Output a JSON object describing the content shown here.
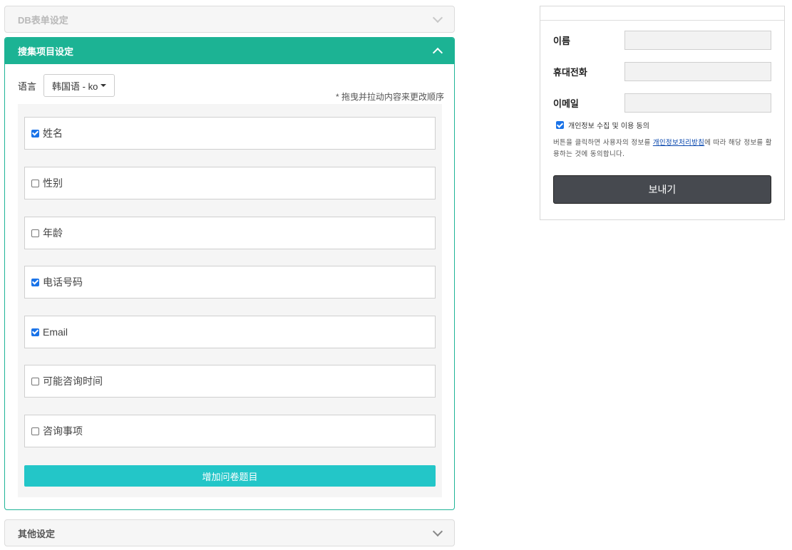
{
  "panels": {
    "db_form": {
      "title": "DB表单设定"
    },
    "collect": {
      "title": "搜集项目设定",
      "language_label": "语言",
      "language_value": "韩国语 - ko",
      "drag_hint": "* 拖曳并拉动内容来更改顺序",
      "items": [
        {
          "label": "姓名",
          "checked": true
        },
        {
          "label": "性别",
          "checked": false
        },
        {
          "label": "年龄",
          "checked": false
        },
        {
          "label": "电话号码",
          "checked": true
        },
        {
          "label": "Email",
          "checked": true
        },
        {
          "label": "可能咨询时间",
          "checked": false
        },
        {
          "label": "咨询事项",
          "checked": false
        }
      ],
      "add_button": "增加问卷题目"
    },
    "other": {
      "title": "其他设定"
    }
  },
  "preview": {
    "fields": [
      {
        "label": "이름"
      },
      {
        "label": "휴대전화"
      },
      {
        "label": "이메일"
      }
    ],
    "consent_label": "개인정보 수집 및 이용 동의",
    "consent_checked": true,
    "notice_before": "버튼을 클릭하면 사용자의 정보를 ",
    "notice_link": "개인정보처리방침",
    "notice_after": "에 따라 해당 정보를 활용하는 것에 동의합니다.",
    "submit_label": "보내기"
  },
  "colors": {
    "accent": "#1cb394",
    "add_button": "#23c6c8",
    "submit_button": "#46494f",
    "checkbox": "#1a73e8"
  }
}
